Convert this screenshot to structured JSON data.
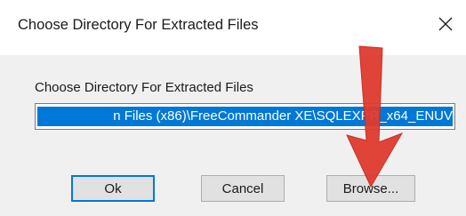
{
  "dialog": {
    "title": "Choose Directory For Extracted Files",
    "close_icon": "close-icon"
  },
  "form": {
    "label": "Choose Directory For Extracted Files",
    "path_value": "n Files (x86)\\FreeCommander XE\\SQLEXPR_x64_ENUV"
  },
  "buttons": {
    "ok": "Ok",
    "cancel": "Cancel",
    "browse": "Browse..."
  },
  "annotation": {
    "arrow_icon": "red-arrow-annotation",
    "arrow_color": "#e03a2f"
  },
  "colors": {
    "selection": "#0078d7",
    "dialog_bg": "#f0f0f0"
  }
}
